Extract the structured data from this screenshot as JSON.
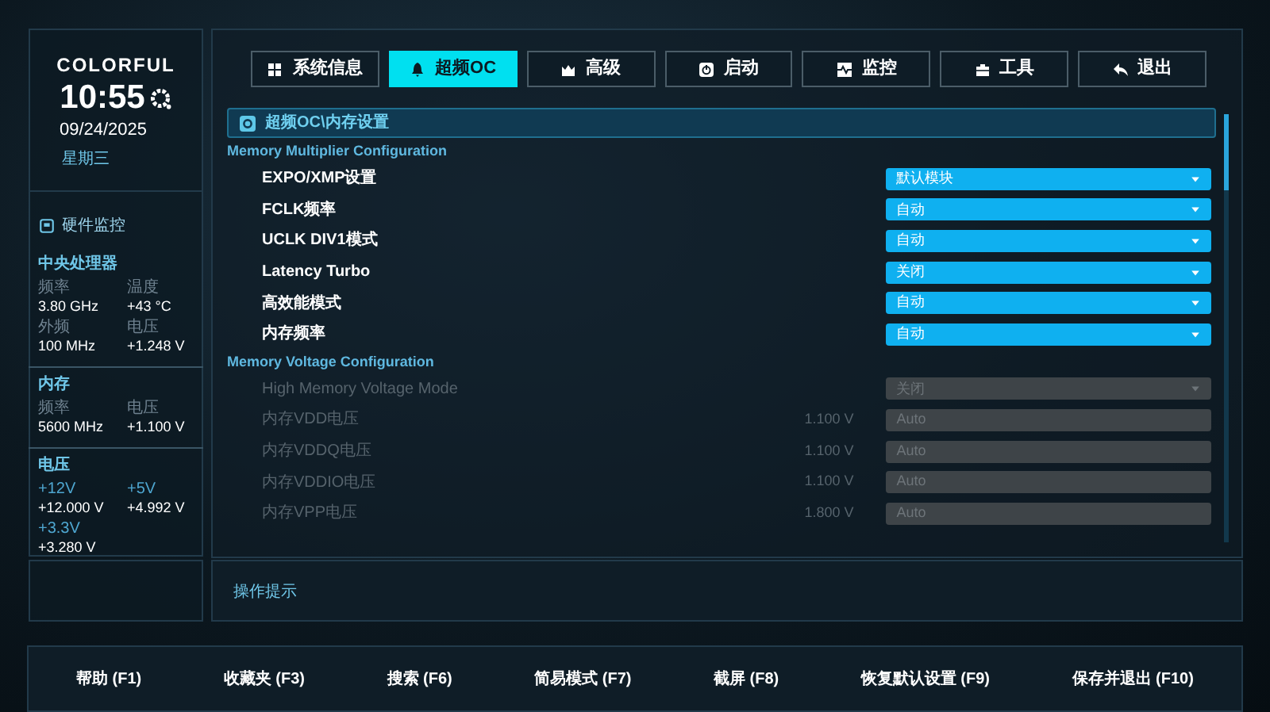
{
  "brand": {
    "logo": "COLORFUL",
    "time": "10:55",
    "date": "09/24/2025",
    "weekday": "星期三"
  },
  "monitor": {
    "title": "硬件监控",
    "groups": [
      {
        "title": "中央处理器",
        "readings": [
          {
            "label": "频率",
            "value": "3.80 GHz"
          },
          {
            "label": "温度",
            "value": "+43 °C"
          },
          {
            "label": "外频",
            "value": "100 MHz"
          },
          {
            "label": "电压",
            "value": "+1.248 V"
          }
        ]
      },
      {
        "title": "内存",
        "readings": [
          {
            "label": "频率",
            "value": "5600 MHz"
          },
          {
            "label": "电压",
            "value": "+1.100 V"
          }
        ]
      },
      {
        "title": "电压",
        "readings": [
          {
            "label": "+12V",
            "value": "+12.000 V"
          },
          {
            "label": "+5V",
            "value": "+4.992 V"
          },
          {
            "label": "+3.3V",
            "value": "+3.280 V"
          }
        ]
      }
    ]
  },
  "tabs": [
    {
      "label": "系统信息",
      "selected": false
    },
    {
      "label": "超频OC",
      "selected": true
    },
    {
      "label": "高级",
      "selected": false
    },
    {
      "label": "启动",
      "selected": false
    },
    {
      "label": "监控",
      "selected": false
    },
    {
      "label": "工具",
      "selected": false
    },
    {
      "label": "退出",
      "selected": false
    }
  ],
  "breadcrumb": "超频OC\\内存设置",
  "sections": [
    {
      "title": "Memory Multiplier Configuration",
      "items": [
        {
          "kind": "dropdown",
          "label": "EXPO/XMP设置",
          "value": "默认模块",
          "disabled": false
        },
        {
          "kind": "dropdown",
          "label": "FCLK频率",
          "value": "自动",
          "disabled": false
        },
        {
          "kind": "dropdown",
          "label": "UCLK DIV1模式",
          "value": "自动",
          "disabled": false
        },
        {
          "kind": "dropdown",
          "label": "Latency Turbo",
          "value": "关闭",
          "disabled": false
        },
        {
          "kind": "dropdown",
          "label": "高效能模式",
          "value": "自动",
          "disabled": false
        },
        {
          "kind": "dropdown",
          "label": "内存频率",
          "value": "自动",
          "disabled": false
        }
      ]
    },
    {
      "title": "Memory Voltage Configuration",
      "items": [
        {
          "kind": "dropdown",
          "label": "High Memory Voltage Mode",
          "value": "关闭",
          "disabled": true
        },
        {
          "kind": "input",
          "label": "内存VDD电压",
          "reading": "1.100 V",
          "value": "Auto",
          "disabled": true
        },
        {
          "kind": "input",
          "label": "内存VDDQ电压",
          "reading": "1.100 V",
          "value": "Auto",
          "disabled": true
        },
        {
          "kind": "input",
          "label": "内存VDDIO电压",
          "reading": "1.100 V",
          "value": "Auto",
          "disabled": true
        },
        {
          "kind": "input",
          "label": "内存VPP电压",
          "reading": "1.800 V",
          "value": "Auto",
          "disabled": true
        }
      ]
    }
  ],
  "hint": {
    "title": "操作提示"
  },
  "footer": [
    "帮助 (F1)",
    "收藏夹 (F3)",
    "搜索 (F6)",
    "简易模式 (F7)",
    "截屏 (F8)",
    "恢复默认设置 (F9)",
    "保存并退出 (F10)"
  ]
}
